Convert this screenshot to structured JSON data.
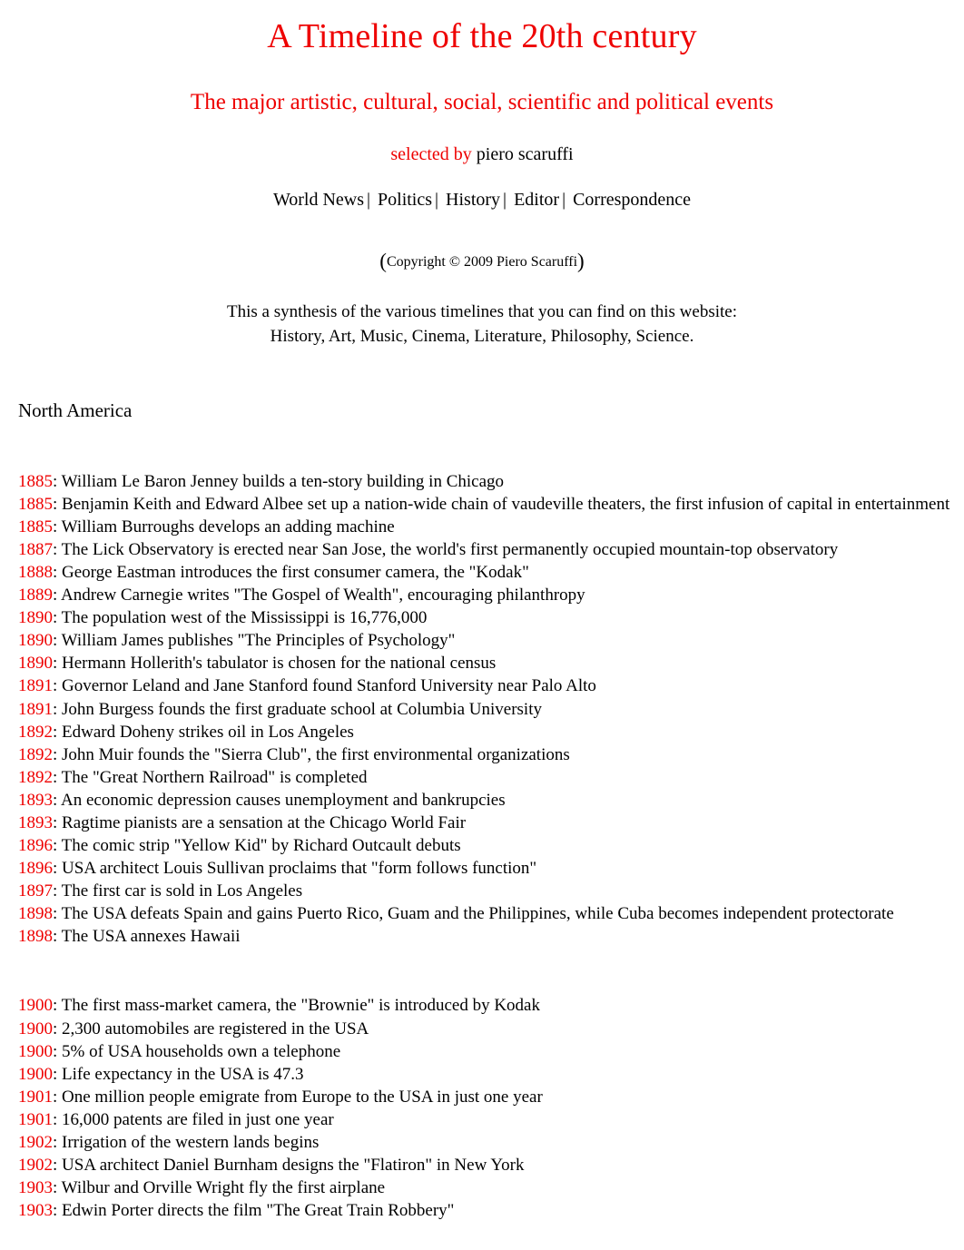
{
  "colors": {
    "accent_red": "#ee0000",
    "text_black": "#000000",
    "background": "#ffffff"
  },
  "header": {
    "title": "A Timeline of the 20th century",
    "subtitle": "The major artistic, cultural, social, scientific and political events",
    "selected_by_label": "selected by",
    "author": "piero scaruffi",
    "nav": [
      {
        "label": "World News"
      },
      {
        "label": "Politics"
      },
      {
        "label": "History"
      },
      {
        "label": "Editor"
      },
      {
        "label": "Correspondence"
      }
    ],
    "nav_separator": "|",
    "copyright_open_paren": "(",
    "copyright": "Copyright © 2009 Piero Scaruffi",
    "copyright_close_paren": ")",
    "synthesis_line1": "This a synthesis of the various timelines that you can find on this website:",
    "synthesis_line2": "History, Art, Music, Cinema, Literature, Philosophy, Science."
  },
  "section": {
    "heading": "North America"
  },
  "entries_group_1": [
    {
      "year": "1885",
      "text": ": William Le Baron Jenney builds a ten-story building in Chicago"
    },
    {
      "year": "1885",
      "text": ": Benjamin Keith and Edward Albee set up a nation-wide chain of vaudeville theaters, the first infusion of capital in entertainment"
    },
    {
      "year": "1885",
      "text": ": William Burroughs develops an adding machine"
    },
    {
      "year": "1887",
      "text": ": The Lick Observatory is erected near San Jose, the world's first permanently occupied mountain-top observatory"
    },
    {
      "year": "1888",
      "text": ": George Eastman introduces the first consumer camera, the \"Kodak\""
    },
    {
      "year": "1889",
      "text": ": Andrew Carnegie writes \"The Gospel of Wealth\", encouraging philanthropy"
    },
    {
      "year": "1890",
      "text": ": The population west of the Mississippi is 16,776,000"
    },
    {
      "year": "1890",
      "text": ": William James publishes \"The Principles of Psychology\""
    },
    {
      "year": "1890",
      "text": ": Hermann Hollerith's tabulator is chosen for the national census"
    },
    {
      "year": "1891",
      "text": ": Governor Leland and Jane Stanford found Stanford University near Palo Alto"
    },
    {
      "year": "1891",
      "text": ": John Burgess founds the first graduate school at Columbia University"
    },
    {
      "year": "1892",
      "text": ": Edward Doheny strikes oil in Los Angeles"
    },
    {
      "year": "1892",
      "text": ": John Muir founds the \"Sierra Club\", the first environmental organizations"
    },
    {
      "year": "1892",
      "text": ": The \"Great Northern Railroad\" is completed"
    },
    {
      "year": "1893",
      "text": ": An economic depression causes unemployment and bankrupcies"
    },
    {
      "year": "1893",
      "text": ": Ragtime pianists are a sensation at the Chicago World Fair"
    },
    {
      "year": "1896",
      "text": ": The comic strip \"Yellow Kid\" by Richard Outcault debuts"
    },
    {
      "year": "1896",
      "text": ": USA architect Louis Sullivan proclaims that \"form follows function\""
    },
    {
      "year": "1897",
      "text": ": The first car is sold in Los Angeles"
    },
    {
      "year": "1898",
      "text": ": The USA defeats Spain and gains Puerto Rico, Guam and the Philippines, while Cuba becomes independent protectorate"
    },
    {
      "year": "1898",
      "text": ": The USA annexes Hawaii"
    }
  ],
  "entries_group_2": [
    {
      "year": "1900",
      "text": ": The first mass-market camera, the \"Brownie\" is introduced by Kodak"
    },
    {
      "year": "1900",
      "text": ": 2,300 automobiles are registered in the USA"
    },
    {
      "year": "1900",
      "text": ": 5% of USA households own a telephone"
    },
    {
      "year": "1900",
      "text": ": Life expectancy in the USA is 47.3"
    },
    {
      "year": "1901",
      "text": ": One million people emigrate from Europe to the USA in just one year"
    },
    {
      "year": "1901",
      "text": ": 16,000 patents are filed in just one year"
    },
    {
      "year": "1902",
      "text": ": Irrigation of the western lands begins"
    },
    {
      "year": "1902",
      "text": ": USA architect Daniel Burnham designs the \"Flatiron\" in New York"
    },
    {
      "year": "1903",
      "text": ": Wilbur and Orville Wright fly the first airplane"
    },
    {
      "year": "1903",
      "text": ": Edwin Porter directs the film \"The Great Train Robbery\""
    }
  ]
}
